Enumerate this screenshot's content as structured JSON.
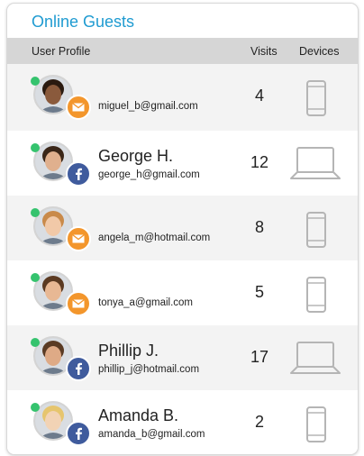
{
  "title": "Online Guests",
  "columns": {
    "profile": "User Profile",
    "visits": "Visits",
    "devices": "Devices"
  },
  "colors": {
    "accent": "#1f9bd1",
    "online": "#35c36e",
    "email_badge": "#f3962c",
    "facebook_badge": "#3f5b9d"
  },
  "guests": [
    {
      "name": "",
      "email": "miguel_b@gmail.com",
      "visits": "4",
      "source": "email-icon",
      "device": "phone-icon"
    },
    {
      "name": "George H.",
      "email": "george_h@gmail.com",
      "visits": "12",
      "source": "facebook-icon",
      "device": "laptop-icon"
    },
    {
      "name": "",
      "email": "angela_m@hotmail.com",
      "visits": "8",
      "source": "email-icon",
      "device": "phone-icon"
    },
    {
      "name": "",
      "email": "tonya_a@gmail.com",
      "visits": "5",
      "source": "email-icon",
      "device": "phone-icon"
    },
    {
      "name": "Phillip J.",
      "email": "phillip_j@hotmail.com",
      "visits": "17",
      "source": "facebook-icon",
      "device": "laptop-icon"
    },
    {
      "name": "Amanda B.",
      "email": "amanda_b@gmail.com",
      "visits": "2",
      "source": "facebook-icon",
      "device": "phone-icon"
    }
  ]
}
